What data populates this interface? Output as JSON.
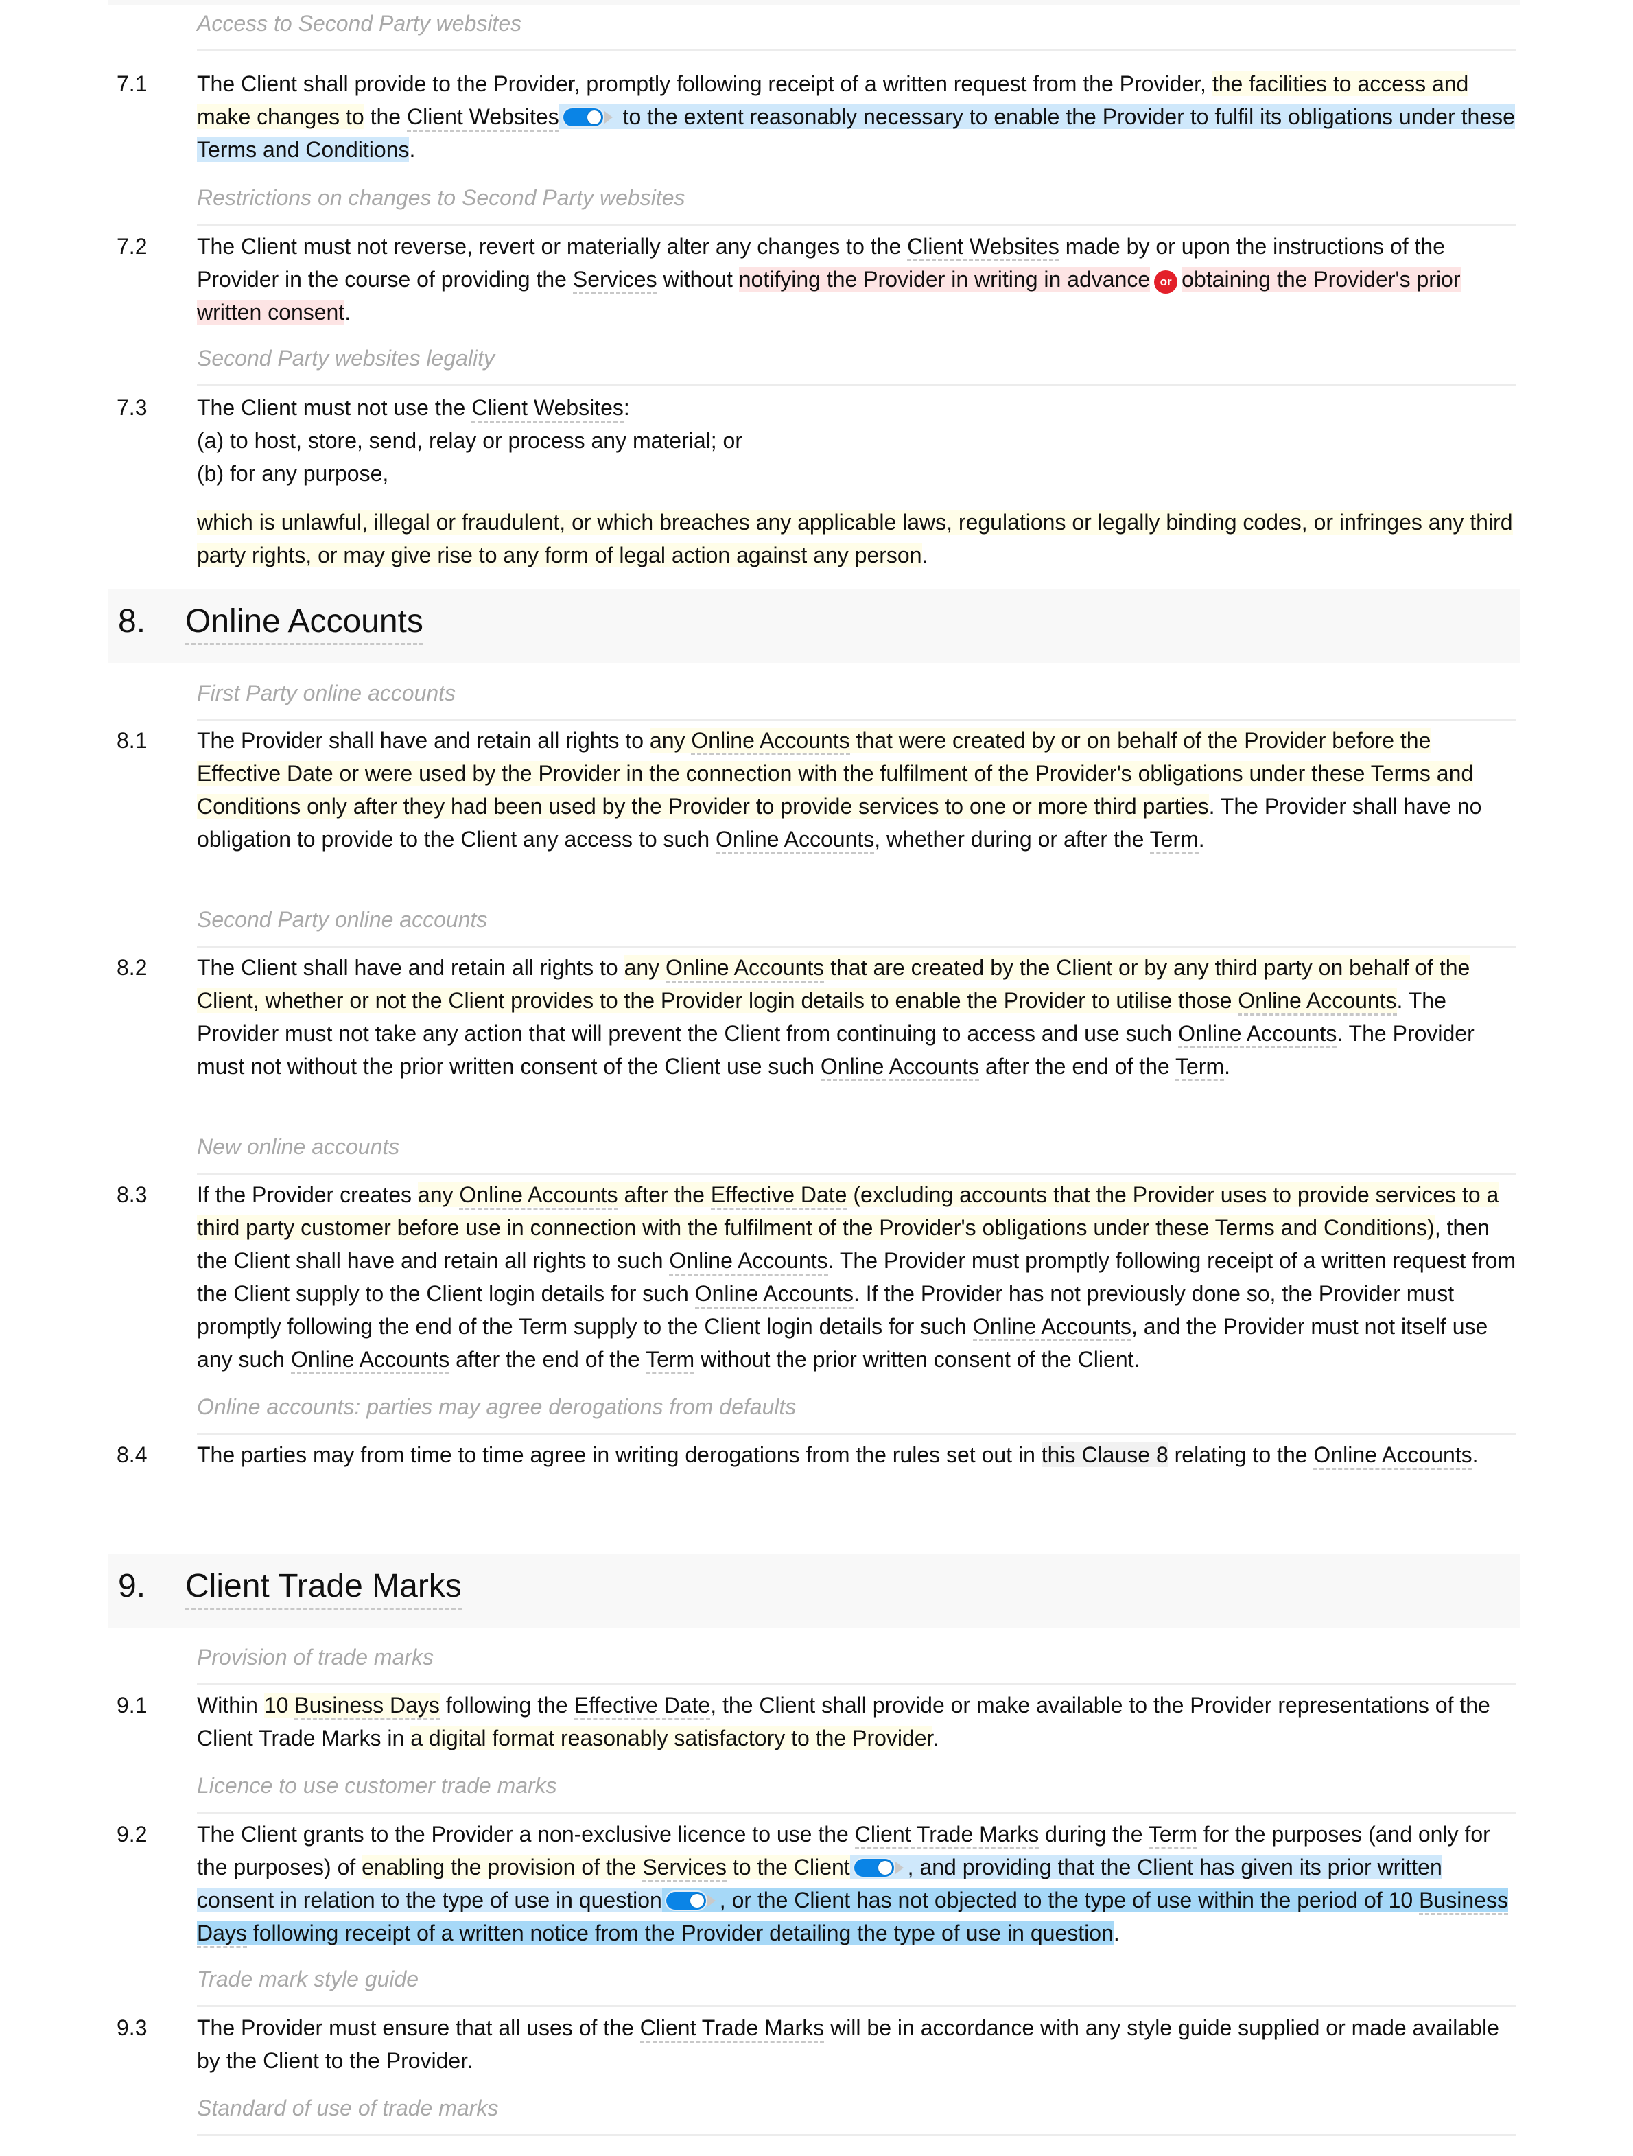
{
  "document": {
    "sections": [
      {
        "number": "8.",
        "title": "Online Accounts"
      },
      {
        "number": "9.",
        "title": "Client Trade Marks"
      }
    ],
    "subheadings": {
      "s7_1": "Access to Second Party websites",
      "s7_2": "Restrictions on changes to Second Party websites",
      "s7_3": "Second Party websites legality",
      "s8_1": "First Party online accounts",
      "s8_2": "Second Party online accounts",
      "s8_3": "New online accounts",
      "s8_4": "Online accounts: parties may agree derogations from defaults",
      "s9_1": "Provision of trade marks",
      "s9_2": "Licence to use customer trade marks",
      "s9_3": "Trade mark style guide",
      "s9_4": "Standard of use of trade marks"
    },
    "clauses": {
      "c7_1": {
        "num": "7.1",
        "t1": "The Client shall provide to the Provider, promptly following receipt of a written request from the Provider, ",
        "h1": "the facilities to access and make changes to",
        "t2": " the ",
        "term1": "Client Websites",
        "h2": " to the extent reasonably necessary to enable the Provider to fulfil its obligations under these Terms and Conditions",
        "t3": "."
      },
      "c7_2": {
        "num": "7.2",
        "t1": "The Client must not reverse, revert or materially alter any changes to the ",
        "term1": "Client Websites",
        "t2": " made by or upon the instructions of the Provider in the course of providing the ",
        "term2": "Services",
        "t3": " without ",
        "h1": "notifying the Provider in writing in advance",
        "or_label": "or",
        "h2": "obtaining the Provider's prior written consent",
        "t4": "."
      },
      "c7_3": {
        "num": "7.3",
        "t1": "The Client must not use the ",
        "term1": "Client Websites",
        "t2": ":",
        "items": [
          "(a)  to host, store, send, relay or process any material; or",
          "(b)  for any purpose,"
        ],
        "tail": "which is unlawful, illegal or fraudulent, or which breaches any applicable laws, regulations or legally binding codes, or infringes any third party rights, or may give rise to any form of legal action against any person",
        "tail_end": "."
      },
      "c8_1": {
        "num": "8.1",
        "t1": "The Provider shall have and retain all rights to ",
        "h1a": "any ",
        "term1": "Online Accounts",
        "h1b": " that were created by or on behalf of the Provider before the Effective Date or were used by the Provider in the connection with the fulfilment of the Provider's obligations under these Terms and Conditions only after they had been used by the Provider to provide services to one or more third parties",
        "t2": ". The Provider shall have no obligation to provide to the Client any access to such ",
        "term2": "Online Accounts",
        "t3": ", whether during or after the ",
        "term3": "Term",
        "t4": "."
      },
      "c8_2": {
        "num": "8.2",
        "t1": "The Client shall have and retain all rights to ",
        "h1a": "any ",
        "term1": "Online Accounts",
        "h1b": " that are created by the Client or by any third party on behalf of the Client, whether or not the Client provides to the Provider login details to enable the Provider to utilise those ",
        "term2": "Online Accounts",
        "t2": ". The Provider must not take any action that will prevent the Client from continuing to access and use such ",
        "term3": "Online Accounts",
        "t3": ". The Provider must not without the prior written consent of the Client use such ",
        "term4": "Online Accounts",
        "t4": " after the end of the ",
        "term5": "Term",
        "t5": "."
      },
      "c8_3": {
        "num": "8.3",
        "t1": "If the Provider creates ",
        "h1a": "any ",
        "term1": "Online Accounts",
        "h1b": " after the ",
        "term2": "Effective Date",
        "h1c": " (excluding accounts that the Provider uses to provide services to a third party customer before use in connection with the fulfilment of the Provider's obligations under these Terms and Conditions)",
        "t2": ", then the Client shall have and retain all rights to such ",
        "term3": "Online Accounts",
        "t3": ". The Provider must promptly following receipt of a written request from the Client supply to the Client login details for such ",
        "term4": "Online Accounts",
        "t4": ". If the Provider has not previously done so, the Provider must promptly following the end of the Term supply to the Client login details for such ",
        "term5": "Online Accounts",
        "t5": ", and the Provider must not itself use any such ",
        "term6": "Online Accounts",
        "t6": " after the end of the ",
        "term7": "Term",
        "t7": " without the prior written consent of the Client."
      },
      "c8_4": {
        "num": "8.4",
        "t1": "The parties may from time to time agree in writing derogations from the rules set out in ",
        "ref": "this Clause 8",
        "t2": " relating to the ",
        "term1": "Online Accounts",
        "t3": "."
      },
      "c9_1": {
        "num": "9.1",
        "t1": "Within ",
        "h1a": "10 ",
        "term1": "Business Days",
        "t2": " following the ",
        "term2": "Effective Date",
        "t3": ", the Client shall provide or make available to the Provider representations of the Client Trade Marks in ",
        "h2": "a digital format reasonably satisfactory to the Provider",
        "t4": "."
      },
      "c9_2": {
        "num": "9.2",
        "t1": "The Client grants to the Provider a non-exclusive licence to use the ",
        "term1": "Client Trade Marks",
        "t2": " during the ",
        "term2": "Term",
        "t3": " for the purposes (and only for the purposes) of ",
        "h1a": "enabling the provision of the ",
        "term3": "Services",
        "h1b": " to the Client",
        "h2": ", and providing that the Client has given its prior written consent in relation to the type of use in question",
        "h3a": ", or the Client has not objected to the type of use within the period of 10 ",
        "term4": "Business Days",
        "h3b": " following receipt of a written notice from the Provider detailing the type of use in question",
        "t4": "."
      },
      "c9_3": {
        "num": "9.3",
        "t1": "The Provider must ensure that all uses of the ",
        "term1": "Client Trade Marks",
        "t2": " will be in accordance with any style guide supplied or made available by the Client to the Provider."
      }
    }
  }
}
